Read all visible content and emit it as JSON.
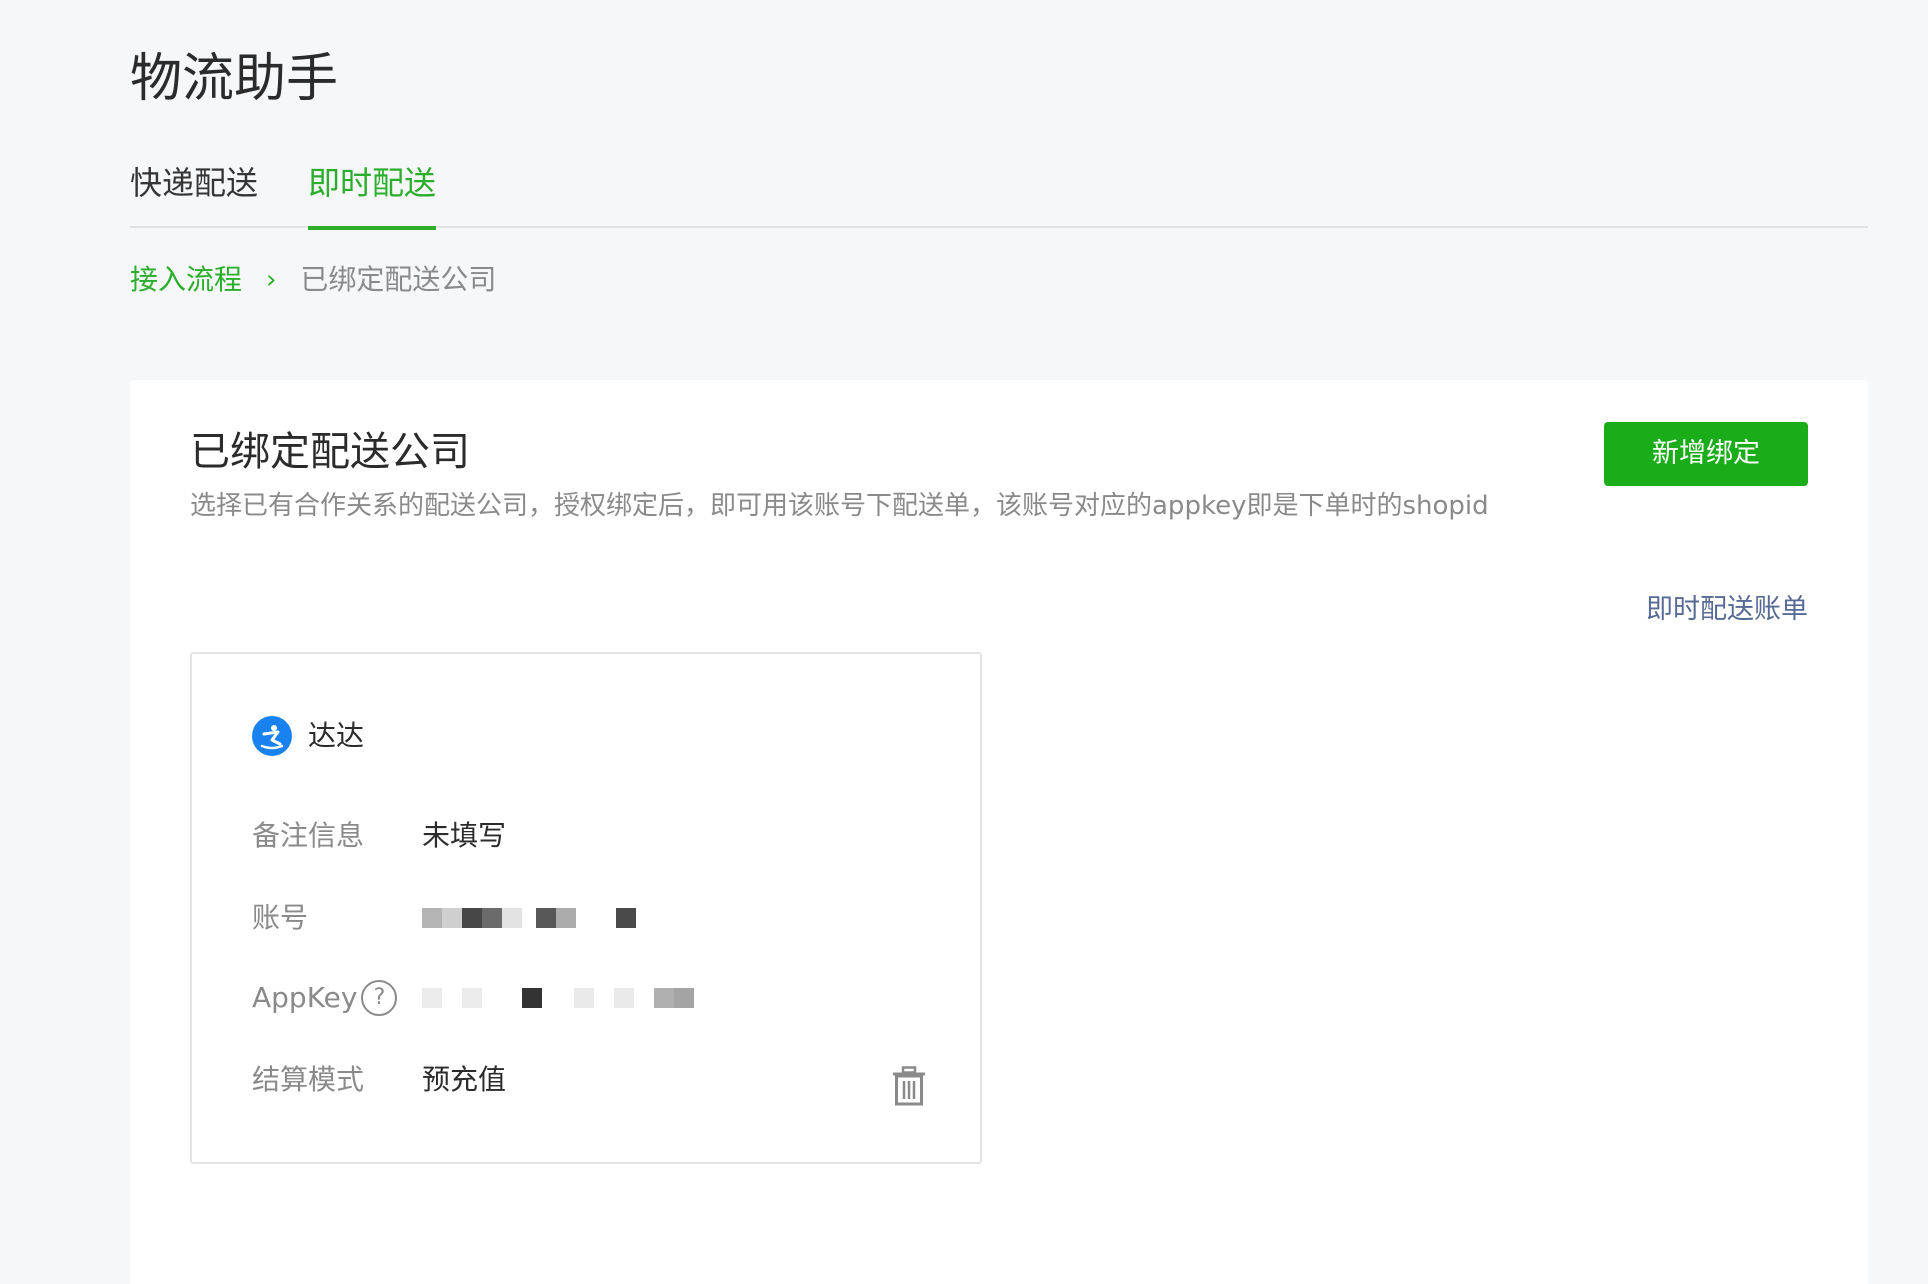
{
  "page": {
    "title": "物流助手"
  },
  "tabs": [
    {
      "label": "快递配送",
      "active": false
    },
    {
      "label": "即时配送",
      "active": true
    }
  ],
  "breadcrumb": {
    "link": "接入流程",
    "separator": "›",
    "current": "已绑定配送公司"
  },
  "panel": {
    "title": "已绑定配送公司",
    "description": "选择已有合作关系的配送公司，授权绑定后，即可用该账号下配送单，该账号对应的appkey即是下单时的shopid",
    "add_button_label": "新增绑定",
    "bill_link_label": "即时配送账单"
  },
  "card": {
    "carrier_icon": "dada-logo-icon",
    "carrier_name": "达达",
    "remark_label": "备注信息",
    "remark_value": "未填写",
    "account_label": "账号",
    "appkey_label": "AppKey",
    "appkey_help": "?",
    "settlement_label": "结算模式",
    "settlement_value": "预充值",
    "delete_icon": "trash-icon"
  },
  "colors": {
    "accent_green": "#2aae2b",
    "button_green": "#1aad19",
    "link_blue": "#576b95",
    "carrier_blue": "#1a82ee"
  }
}
